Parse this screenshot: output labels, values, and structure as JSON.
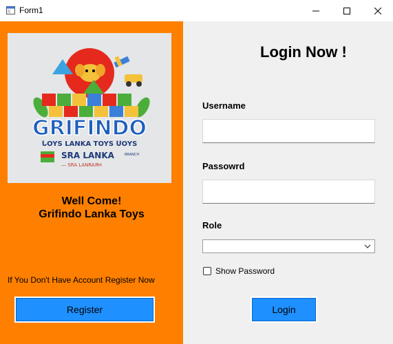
{
  "window": {
    "title": "Form1"
  },
  "left_panel": {
    "logo": {
      "brand": "GRIFINDO",
      "tagline": "ᒐOYS LANKA TOYS ᑌOYS",
      "branch_line1": "SRA LANKA",
      "branch_suffix": "BRANCH",
      "branch_line2": "— SRA LANRAЯH"
    },
    "welcome_line1": "Well Come!",
    "welcome_line2": "Grifindo Lanka Toys",
    "register_hint": "If You Don't Have Account Register Now",
    "register_button": "Register"
  },
  "right_panel": {
    "heading": "Login Now !",
    "username_label": "Username",
    "username_value": "",
    "password_label": "Passowrd",
    "password_value": "",
    "role_label": "Role",
    "role_value": "",
    "show_password_label": "Show Password",
    "show_password_checked": false,
    "login_button": "Login"
  },
  "colors": {
    "left_panel_bg": "#ff8000",
    "button_bg": "#1e90ff",
    "window_bg": "#f0f0f0"
  },
  "icons": [
    "app-icon",
    "minimize-icon",
    "maximize-icon",
    "close-icon",
    "chevron-down-icon",
    "logo-image"
  ]
}
